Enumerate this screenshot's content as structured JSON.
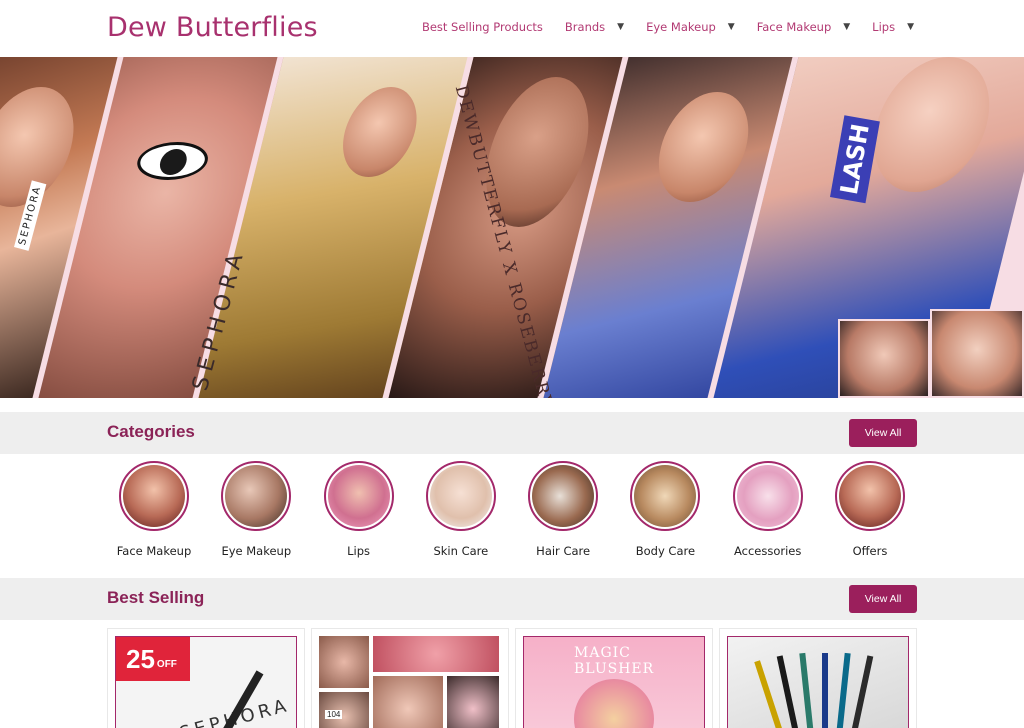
{
  "brand": {
    "name": "Dew Butterflies",
    "color": "#a8316e"
  },
  "nav": {
    "items": [
      {
        "label": "Best Selling Products",
        "has_dropdown": false
      },
      {
        "label": "Brands",
        "has_dropdown": true
      },
      {
        "label": "Eye Makeup",
        "has_dropdown": true
      },
      {
        "label": "Face Makeup",
        "has_dropdown": true
      },
      {
        "label": "Lips",
        "has_dropdown": true
      }
    ],
    "caret": "▼"
  },
  "hero": {
    "banner_text": "DEWBUTTERFLY X ROSEBERRY",
    "product_text_1": "SEPHORA",
    "product_text_2": "SEPHORA",
    "product_text_3": "LASH"
  },
  "categories": {
    "title": "Categories",
    "view_all": "View All",
    "items": [
      {
        "label": "Face Makeup"
      },
      {
        "label": "Eye Makeup"
      },
      {
        "label": "Lips"
      },
      {
        "label": "Skin Care"
      },
      {
        "label": "Hair Care"
      },
      {
        "label": "Body Care"
      },
      {
        "label": "Accessories"
      },
      {
        "label": "Offers"
      }
    ]
  },
  "best_selling": {
    "title": "Best Selling",
    "view_all": "View All",
    "cards": [
      {
        "badge_number": "25",
        "badge_suffix": "OFF",
        "product_text": "SEPHORA"
      },
      {
        "badge_number": "104"
      },
      {
        "product_text": "MAGIC BLUSHER"
      },
      {}
    ]
  },
  "colors": {
    "accent": "#9b1f5c",
    "section_bg": "#eeeeee",
    "badge_red": "#e0243a"
  }
}
